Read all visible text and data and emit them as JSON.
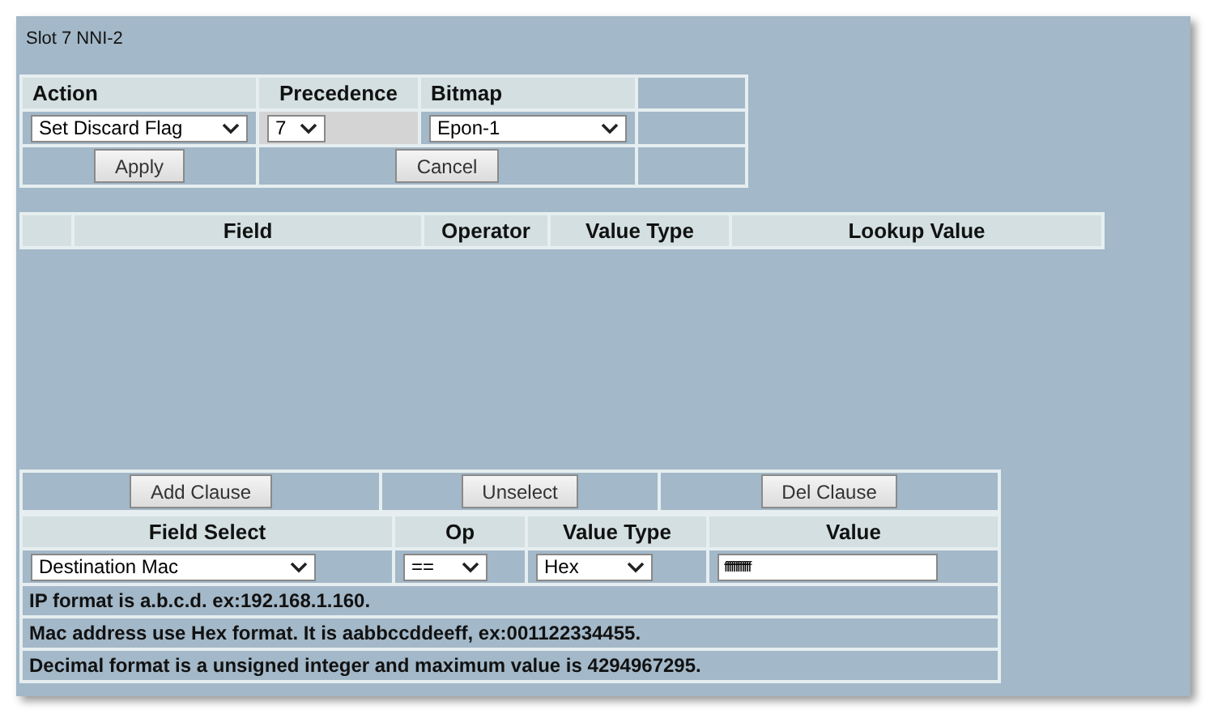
{
  "title": "Slot 7 NNI-2",
  "action_table": {
    "columns": [
      "Action",
      "Precedence",
      "Bitmap"
    ],
    "action": "Set Discard Flag",
    "precedence": "7",
    "bitmap": "Epon-1",
    "buttons": [
      "Apply",
      "Cancel"
    ]
  },
  "clause_table": {
    "columns": [
      "Field",
      "Operator",
      "Value Type",
      "Lookup Value"
    ]
  },
  "clause_buttons": [
    "Add Clause",
    "Unselect",
    "Del Clause"
  ],
  "clause_editor": {
    "columns": [
      "Field Select",
      "Op",
      "Value Type",
      "Value"
    ],
    "field_select": "Destination Mac",
    "op": "==",
    "value_type": "Hex",
    "value": "ffffffffffff"
  },
  "notes": [
    "IP format is a.b.c.d. ex:192.168.1.160.",
    "Mac address use Hex format. It is aabbccddeeff, ex:001122334455.",
    "Decimal format is a unsigned integer and maximum value is 4294967295."
  ]
}
